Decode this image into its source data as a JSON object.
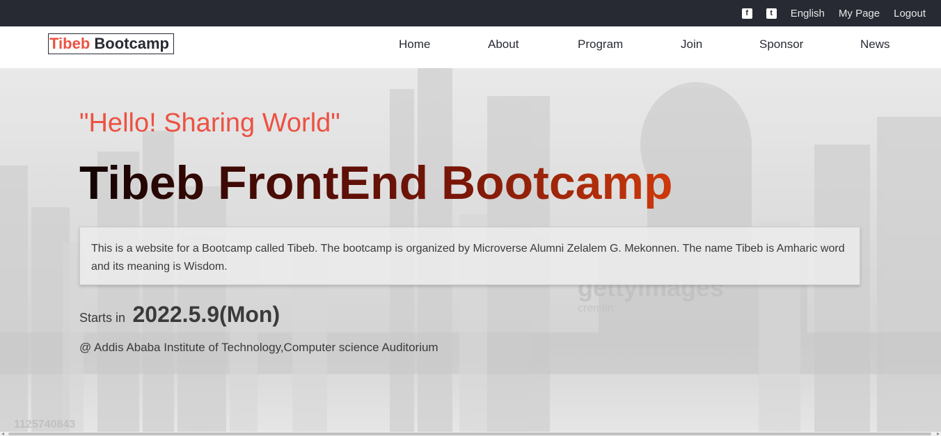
{
  "topbar": {
    "social_icons": [
      "facebook-icon",
      "twitter-icon"
    ],
    "links": [
      "English",
      "My Page",
      "Logout"
    ]
  },
  "nav": {
    "logo": {
      "part1": "Tibeb",
      "part2": " Bootcamp"
    },
    "items": [
      "Home",
      "About",
      "Program",
      "Join",
      "Sponsor",
      "News"
    ]
  },
  "hero": {
    "quote": "\"Hello! Sharing World\"",
    "title": "Tibeb FrontEnd Bootcamp",
    "description": "This is a website for a Bootcamp called Tibeb. The bootcamp is organized by Microverse Alumni Zelalem G. Mekonnen. The name Tibeb is Amharic word and its meaning is Wisdom.",
    "starts_label": "Starts in",
    "start_date": "2022.5.9(Mon)",
    "venue": "@ Addis Ababa Institute of Technology,Computer science Auditorium"
  },
  "background": {
    "watermark": "gettyimages",
    "watermark_sub": "cremlin",
    "image_id": "1125740843"
  },
  "colors": {
    "topbar_bg": "#272a33",
    "accent": "#ec5242",
    "text_dark": "#272a33"
  }
}
